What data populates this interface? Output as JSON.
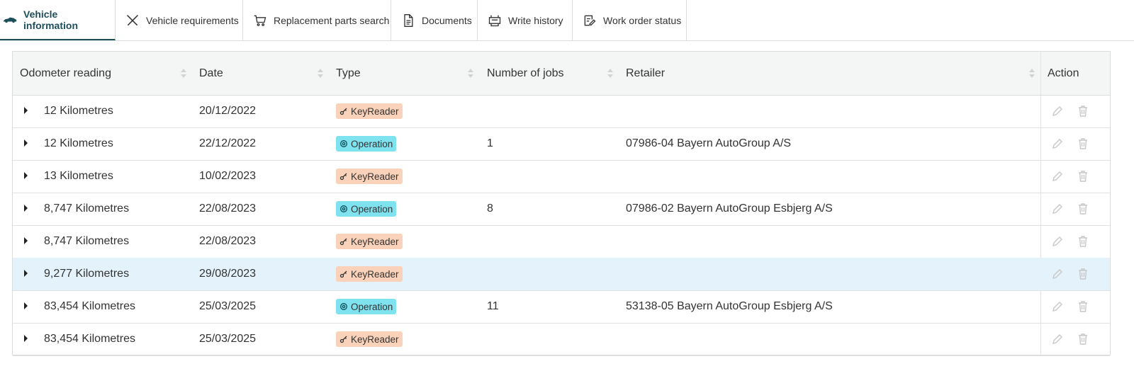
{
  "tabs": [
    {
      "label": "Vehicle information",
      "icon": "car-icon",
      "active": true
    },
    {
      "label": "Vehicle requirements",
      "icon": "tools-icon",
      "active": false
    },
    {
      "label": "Replacement parts search",
      "icon": "cart-icon",
      "active": false
    },
    {
      "label": "Documents",
      "icon": "document-icon",
      "active": false
    },
    {
      "label": "Write history",
      "icon": "printer-icon",
      "active": false
    },
    {
      "label": "Work order status",
      "icon": "edit-list-icon",
      "active": false
    }
  ],
  "table": {
    "headers": {
      "odometer": "Odometer reading",
      "date": "Date",
      "type": "Type",
      "jobs": "Number of jobs",
      "retailer": "Retailer",
      "action": "Action"
    },
    "rows": [
      {
        "odometer": "12 Kilometres",
        "date": "20/12/2022",
        "type": "KeyReader",
        "jobs": "",
        "retailer": ""
      },
      {
        "odometer": "12 Kilometres",
        "date": "22/12/2022",
        "type": "Operation",
        "jobs": "1",
        "retailer": "07986-04 Bayern AutoGroup A/S"
      },
      {
        "odometer": "13 Kilometres",
        "date": "10/02/2023",
        "type": "KeyReader",
        "jobs": "",
        "retailer": ""
      },
      {
        "odometer": "8,747 Kilometres",
        "date": "22/08/2023",
        "type": "Operation",
        "jobs": "8",
        "retailer": "07986-02 Bayern AutoGroup Esbjerg A/S"
      },
      {
        "odometer": "8,747 Kilometres",
        "date": "22/08/2023",
        "type": "KeyReader",
        "jobs": "",
        "retailer": ""
      },
      {
        "odometer": "9,277 Kilometres",
        "date": "29/08/2023",
        "type": "KeyReader",
        "jobs": "",
        "retailer": "",
        "selected": true
      },
      {
        "odometer": "83,454 Kilometres",
        "date": "25/03/2025",
        "type": "Operation",
        "jobs": "11",
        "retailer": "53138-05 Bayern AutoGroup Esbjerg A/S"
      },
      {
        "odometer": "83,454 Kilometres",
        "date": "25/03/2025",
        "type": "KeyReader",
        "jobs": "",
        "retailer": ""
      }
    ]
  },
  "colors": {
    "accent": "#1d4f5a",
    "keyreader_badge": "#f9d2b9",
    "operation_badge": "#7fe2ef",
    "selected_row": "#e3f2fb"
  }
}
